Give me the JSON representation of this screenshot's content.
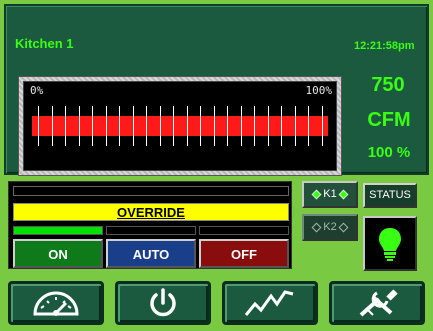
{
  "header": {
    "room": "Kitchen 1",
    "time": "12:21:58pm"
  },
  "meter": {
    "min_label": "0%",
    "max_label": "100%",
    "level_fraction": 1.0,
    "tick_count": 22
  },
  "airflow": {
    "value": "750",
    "unit": "CFM",
    "percent": "100 %"
  },
  "controls": {
    "banner": "OVERRIDE",
    "on_label": "ON",
    "auto_label": "AUTO",
    "off_label": "OFF",
    "active_mode": "ON"
  },
  "relays": {
    "k1_label": "K1",
    "k1_state": "on",
    "k2_label": "K2",
    "k2_state": "off"
  },
  "status_label": "STATUS",
  "lamp": {
    "state": "on",
    "color": "#39ff14"
  },
  "nav": {
    "items": [
      {
        "name": "gauge-icon"
      },
      {
        "name": "power-icon"
      },
      {
        "name": "trend-icon"
      },
      {
        "name": "tools-icon"
      }
    ]
  },
  "colors": {
    "background": "#7ac943",
    "panel": "#1b5a3e",
    "accent": "#39ff14",
    "meter_bar": "#ff1a1a",
    "banner": "#ffff00"
  }
}
